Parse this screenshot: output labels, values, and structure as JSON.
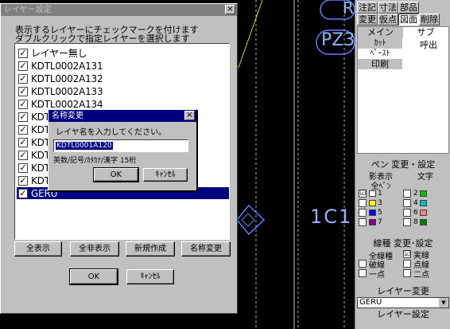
{
  "canvas": {
    "texts": [
      {
        "text": "1C1"
      },
      {
        "text": "PZ3"
      },
      {
        "text": "R"
      }
    ]
  },
  "cmd_panel": {
    "toolbar_row1": [
      "注記",
      "寸法",
      "部品"
    ],
    "toolbar_row2": [
      "変更",
      "仮点",
      "図面",
      "削除"
    ],
    "main_tab": "メイン",
    "sub_tab": "サブ",
    "main_items": [
      "ｶｯﾄ",
      "ﾍﾟｰｽﾄ",
      "印刷"
    ],
    "sub_items": [
      "呼出"
    ],
    "pen_title": "ペン 変更・設定",
    "shadow_label": "影表示",
    "text_label": "文字",
    "all_pen_label": "全ﾍﾟﾝ",
    "pens": [
      {
        "num": "1",
        "color": "#ffffff",
        "checked": "☑"
      },
      {
        "num": "3",
        "color": "#ffff00",
        "checked": ""
      },
      {
        "num": "5",
        "color": "#0000ff",
        "checked": ""
      },
      {
        "num": "7",
        "color": "#800080",
        "checked": ""
      }
    ],
    "pens_right": [
      {
        "num": "2",
        "color": "#00c000"
      },
      {
        "num": "4",
        "color": "#00c0c0"
      },
      {
        "num": "6",
        "color": "#ff8080"
      },
      {
        "num": "8",
        "color": "#008000"
      }
    ],
    "linetype_title": "線種 変更･設定",
    "linetypes": [
      {
        "left": "全線種",
        "right": "実線",
        "rchecked": "☑"
      },
      {
        "left": "破線",
        "right": "点線",
        "rchecked": ""
      },
      {
        "left": "一点",
        "right": "二点",
        "rchecked": ""
      }
    ],
    "layer_change_title": "レイヤー変更",
    "layer_current": "GERU",
    "layer_setting_title": "レイヤー設定"
  },
  "layer_dialog": {
    "title": "レイヤー設定",
    "close": "×",
    "instruction_line1": "表示するレイヤーにチェックマークを付けます",
    "instruction_line2": "ダブルクリックで指定レイヤーを選択します",
    "layers": [
      {
        "name": "レイヤー無し",
        "checked": "✓"
      },
      {
        "name": "KDTL0002A131",
        "checked": "✓"
      },
      {
        "name": "KDTL0002A132",
        "checked": "✓"
      },
      {
        "name": "KDTL0002A133",
        "checked": "✓"
      },
      {
        "name": "KDTL0002A134",
        "checked": "✓"
      },
      {
        "name": "KDT",
        "checked": "✓"
      },
      {
        "name": "KDT",
        "checked": "✓"
      },
      {
        "name": "KDT",
        "checked": "✓"
      },
      {
        "name": "KDT",
        "checked": "✓"
      },
      {
        "name": "KDT",
        "checked": "✓"
      },
      {
        "name": "KDT",
        "checked": "✓"
      },
      {
        "name": "GERU",
        "checked": "✓"
      }
    ],
    "buttons": {
      "show_all": "全表示",
      "hide_all": "全非表示",
      "new": "新規作成",
      "rename": "名称変更",
      "ok": "OK",
      "cancel": "ｷｬﾝｾﾙ"
    }
  },
  "rename_dialog": {
    "title": "名称変更",
    "close": "×",
    "prompt": "レイヤ名を入力してください。",
    "value": "KDTL0001A120",
    "hint": "英数/記号/ｶﾀｶﾅ/漢字 15桁",
    "ok": "OK",
    "cancel": "ｷｬﾝｾﾙ"
  }
}
